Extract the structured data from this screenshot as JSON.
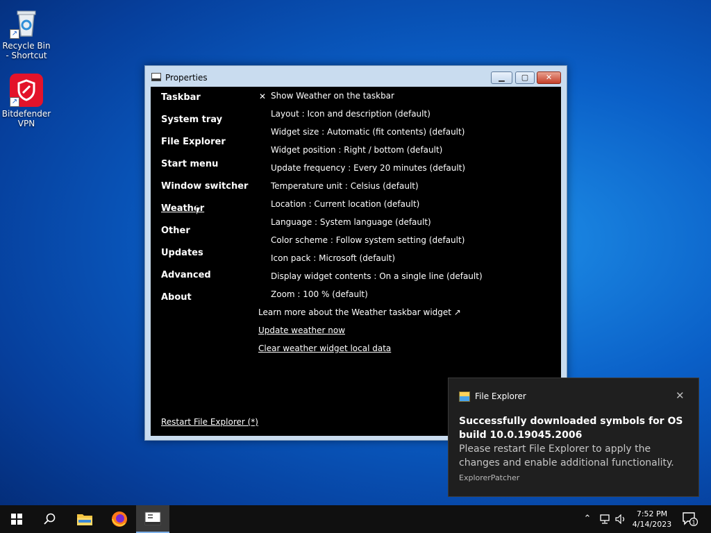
{
  "desktop": {
    "icons": [
      {
        "label": "Recycle Bin - Shortcut"
      },
      {
        "label": "Bitdefender VPN"
      }
    ]
  },
  "window": {
    "title": "Properties",
    "nav": [
      "Taskbar",
      "System tray",
      "File Explorer",
      "Start menu",
      "Window switcher",
      "Weather",
      "Other",
      "Updates",
      "Advanced",
      "About"
    ],
    "active_nav": "Weather",
    "checkbox": "Show Weather on the taskbar",
    "options": [
      "Layout : Icon and description (default)",
      "Widget size : Automatic (fit contents) (default)",
      "Widget position : Right / bottom (default)",
      "Update frequency : Every 20 minutes (default)",
      "Temperature unit : Celsius (default)",
      "Location : Current location (default)",
      "Language : System language (default)",
      "Color scheme : Follow system setting (default)",
      "Icon pack : Microsoft (default)",
      "Display widget contents : On a single line (default)",
      "Zoom : 100 % (default)"
    ],
    "learn_more": "Learn more about the Weather taskbar widget ↗",
    "update_now": "Update weather now",
    "clear_data": "Clear weather widget local data",
    "restart": "Restart File Explorer (*)"
  },
  "toast": {
    "app": "File Explorer",
    "title": "Successfully downloaded symbols for OS build 10.0.19045.2006",
    "body": "Please restart File Explorer to apply the changes and enable additional functionality.",
    "attribution": "ExplorerPatcher"
  },
  "taskbar": {
    "time": "7:52 PM",
    "date": "4/14/2023",
    "notification_count": "1"
  }
}
